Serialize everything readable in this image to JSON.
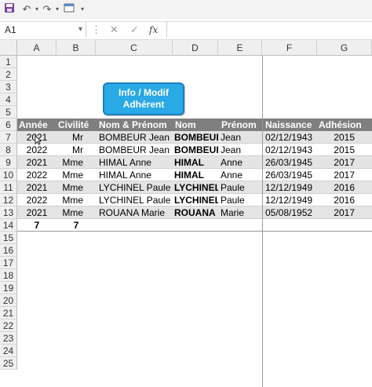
{
  "toolbar": {
    "save_icon": "save-icon",
    "undo_icon": "undo-icon",
    "redo_icon": "redo-icon",
    "form_icon": "form-icon",
    "customize_icon": "customize-qat-icon"
  },
  "formula_bar": {
    "name_box": "A1",
    "cancel": "✕",
    "confirm": "✓",
    "fx": "fx",
    "value": ""
  },
  "columns": [
    "A",
    "B",
    "C",
    "D",
    "E",
    "F",
    "G"
  ],
  "rows": [
    "1",
    "2",
    "3",
    "4",
    "5",
    "6",
    "7",
    "8",
    "9",
    "10",
    "11",
    "12",
    "13",
    "14",
    "15",
    "16",
    "17",
    "18",
    "19",
    "20",
    "21",
    "22",
    "23",
    "24",
    "25"
  ],
  "button": {
    "line1": "Info / Modif",
    "line2": "Adhérent",
    "color": "#29a9e6"
  },
  "table": {
    "headers": [
      "Année",
      "Civilité",
      "Nom & Prénom",
      "Nom",
      "Prénom",
      "Naissance",
      "Adhésion"
    ],
    "rows": [
      [
        "2021",
        "Mr",
        "BOMBEUR Jean",
        "BOMBEUR",
        "Jean",
        "02/12/1943",
        "2015"
      ],
      [
        "2022",
        "Mr",
        "BOMBEUR Jean",
        "BOMBEUR",
        "Jean",
        "02/12/1943",
        "2015"
      ],
      [
        "2021",
        "Mme",
        "HIMAL Anne",
        "HIMAL",
        "Anne",
        "26/03/1945",
        "2017"
      ],
      [
        "2022",
        "Mme",
        "HIMAL Anne",
        "HIMAL",
        "Anne",
        "26/03/1945",
        "2017"
      ],
      [
        "2021",
        "Mme",
        "LYCHINEL Paule",
        "LYCHINEL",
        "Paule",
        "12/12/1949",
        "2016"
      ],
      [
        "2022",
        "Mme",
        "LYCHINEL Paule",
        "LYCHINEL",
        "Paule",
        "12/12/1949",
        "2016"
      ],
      [
        "2021",
        "Mme",
        "ROUANA Marie",
        "ROUANA",
        "Marie",
        "05/08/1952",
        "2017"
      ]
    ],
    "totals": [
      "7",
      "7"
    ],
    "header_bg": "#7f7f7f",
    "band_color": "#e4e4e4"
  }
}
